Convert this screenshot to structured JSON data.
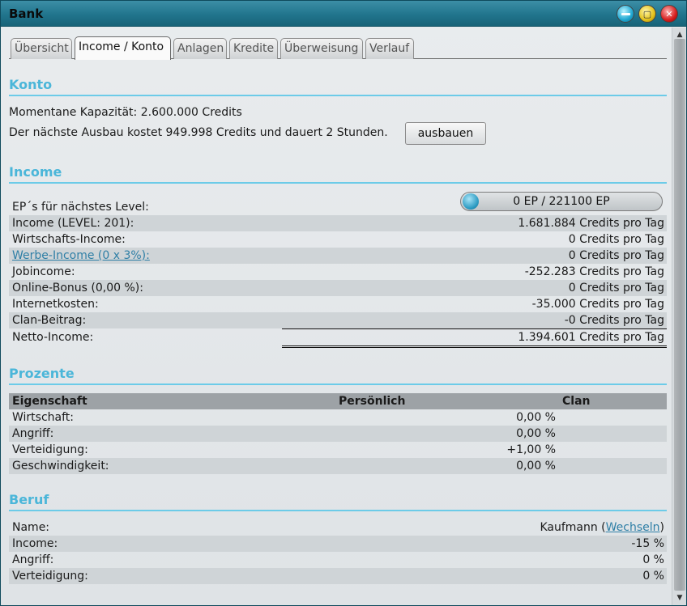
{
  "window": {
    "title": "Bank"
  },
  "tabs": [
    {
      "label": "Übersicht"
    },
    {
      "label": "Income / Konto"
    },
    {
      "label": "Anlagen"
    },
    {
      "label": "Kredite"
    },
    {
      "label": "Überweisung"
    },
    {
      "label": "Verlauf"
    }
  ],
  "konto": {
    "title": "Konto",
    "capacity_text": "Momentane Kapazität: 2.600.000 Credits",
    "upgrade_text": "Der nächste Ausbau kostet 949.998 Credits und dauert 2 Stunden.",
    "upgrade_button": "ausbauen"
  },
  "income": {
    "title": "Income",
    "ep_label": "EP´s für nächstes Level:",
    "ep_value": "0 EP / 221100 EP",
    "ep_progress": 0,
    "rows": [
      {
        "label": "Income (LEVEL: 201):",
        "value": "1.681.884 Credits pro Tag"
      },
      {
        "label": "Wirtschafts-Income:",
        "value": "0 Credits pro Tag"
      },
      {
        "label": "Werbe-Income (0 x 3%):",
        "value": "0 Credits pro Tag"
      },
      {
        "label": "Jobincome:",
        "value": "-252.283 Credits pro Tag"
      },
      {
        "label": "Online-Bonus (0,00 %):",
        "value": "0 Credits pro Tag"
      },
      {
        "label": "Internetkosten:",
        "value": "-35.000 Credits pro Tag"
      },
      {
        "label": "Clan-Beitrag:",
        "value": "-0 Credits pro Tag"
      }
    ],
    "net": {
      "label": "Netto-Income:",
      "value": "1.394.601 Credits pro Tag"
    }
  },
  "prozente": {
    "title": "Prozente",
    "headers": {
      "col1": "Eigenschaft",
      "col2": "Persönlich",
      "col3": "Clan"
    },
    "rows": [
      {
        "label": "Wirtschaft:",
        "personal": "0,00 %"
      },
      {
        "label": "Angriff:",
        "personal": "0,00 %"
      },
      {
        "label": "Verteidigung:",
        "personal": "+1,00 %"
      },
      {
        "label": "Geschwindigkeit:",
        "personal": "0,00 %"
      }
    ]
  },
  "beruf": {
    "title": "Beruf",
    "name_label": "Name:",
    "name_value": "Kaufmann",
    "paren_open": "(",
    "change_link": "Wechseln",
    "paren_close": ")",
    "rows": [
      {
        "label": "Income:",
        "value": "-15 %"
      },
      {
        "label": "Angriff:",
        "value": "0 %"
      },
      {
        "label": "Verteidigung:",
        "value": "0 %"
      }
    ]
  }
}
